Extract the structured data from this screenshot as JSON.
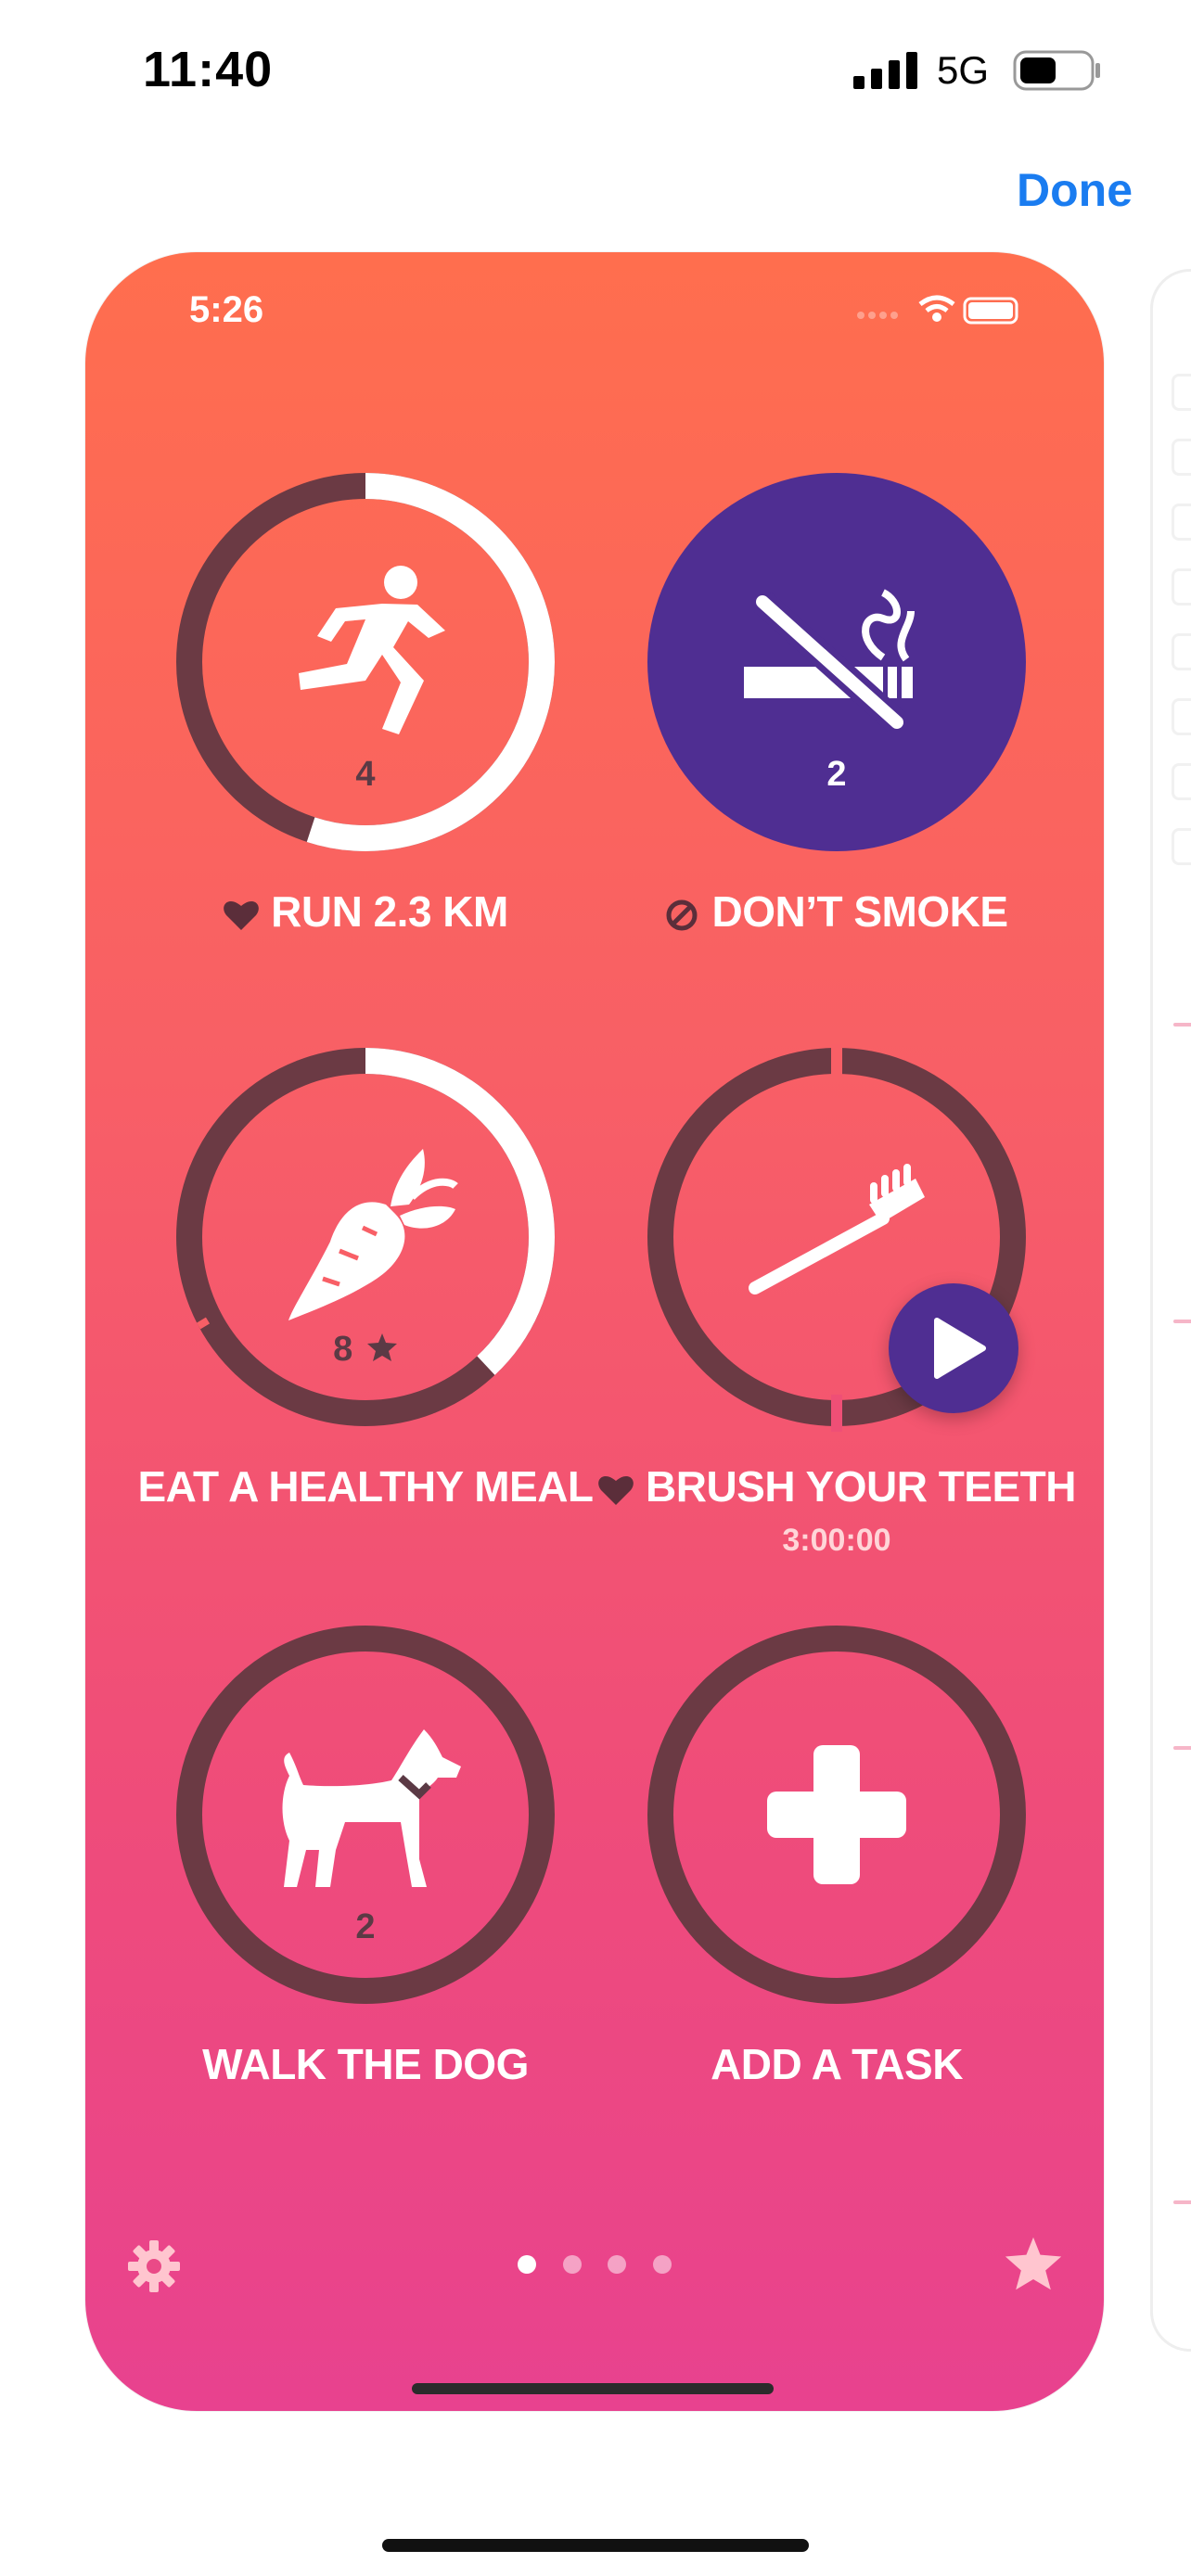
{
  "status_bar": {
    "time": "11:40",
    "network": "5G"
  },
  "header": {
    "done_label": "Done"
  },
  "card": {
    "inner_time": "5:26",
    "tasks": [
      {
        "label": "RUN 2.3 KM",
        "count": "4",
        "icon": "runner-icon",
        "prefix_icon": "heart-icon",
        "progress": 0.55
      },
      {
        "label": "DON’T SMOKE",
        "count": "2",
        "icon": "no-smoking-icon",
        "prefix_icon": "prohibited-icon",
        "progress": 1.0
      },
      {
        "label": "EAT A HEALTHY MEAL",
        "count": "8",
        "icon": "carrot-icon",
        "badge_icon": "star-icon",
        "progress": 0.38
      },
      {
        "label": "BRUSH YOUR TEETH",
        "sublabel": "3:00:00",
        "icon": "toothbrush-icon",
        "prefix_icon": "heart-icon",
        "progress": 0.0
      },
      {
        "label": "WALK THE DOG",
        "count": "2",
        "icon": "dog-icon",
        "progress": 0.0
      },
      {
        "label": "ADD A TASK",
        "icon": "plus-icon",
        "progress": 0.0
      }
    ],
    "page_dots": {
      "count": 4,
      "active": 0
    },
    "bottom_icons": {
      "left": "gear-icon",
      "right": "star-icon"
    }
  },
  "colors": {
    "accent": "#1a7cf0",
    "purple": "#4f2e92",
    "ring_track": "#6b3a44",
    "ring_fill": "#ffffff"
  }
}
